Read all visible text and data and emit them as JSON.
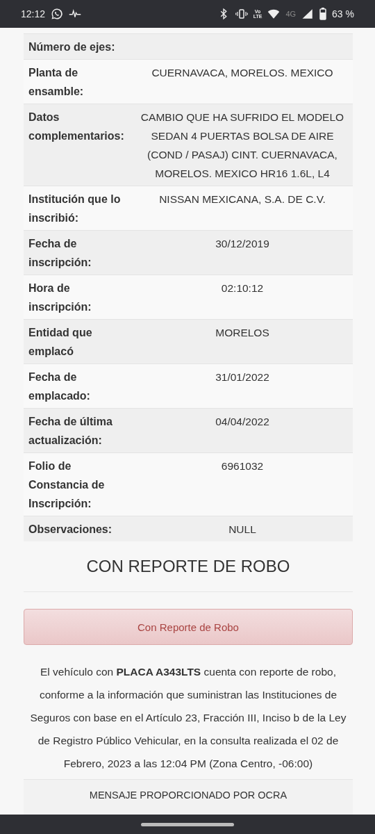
{
  "status_bar": {
    "time": "12:12",
    "network": "4G",
    "battery": "63 %",
    "volte_top": "Vo",
    "volte_bottom": "LTE"
  },
  "details": [
    {
      "label": "Número de ejes:"
    },
    {
      "label": "Planta de ensamble:",
      "value": "CUERNAVACA, MORELOS. MEXICO"
    },
    {
      "label": "Datos complementarios:",
      "value": "CAMBIO QUE HA SUFRIDO EL MODELO SEDAN 4 PUERTAS BOLSA DE AIRE (COND / PASAJ) CINT. CUERNAVACA, MORELOS. MEXICO HR16 1.6L, L4"
    },
    {
      "label": "Institución que lo inscribió:",
      "value": "NISSAN MEXICANA, S.A. DE C.V."
    },
    {
      "label": "Fecha de inscripción:",
      "value": "30/12/2019"
    },
    {
      "label": "Hora de inscripción:",
      "value": "02:10:12"
    },
    {
      "label": "Entidad que emplacó",
      "value": "MORELOS"
    },
    {
      "label": "Fecha de emplacado:",
      "value": "31/01/2022"
    },
    {
      "label": "Fecha de última actualización:",
      "value": "04/04/2022"
    },
    {
      "label": "Folio de Constancia de Inscripción:",
      "value": "6961032"
    },
    {
      "label": "Observaciones:",
      "value": "NULL"
    }
  ],
  "status_heading": "CON REPORTE DE ROBO",
  "alert": "Con Reporte de Robo",
  "message": "El vehículo con **PLACA A343LTS** cuenta con reporte de robo, conforme a la información que suministran las Instituciones de Seguros con base en el Artículo 23, Fracción III, Inciso b de la Ley de Registro Público Vehicular, en la consulta realizada el 02 de Febrero, 2023 a las 12:04 PM (Zona Centro, -06:00)",
  "footer": "MENSAJE PROPORCIONADO POR OCRA"
}
